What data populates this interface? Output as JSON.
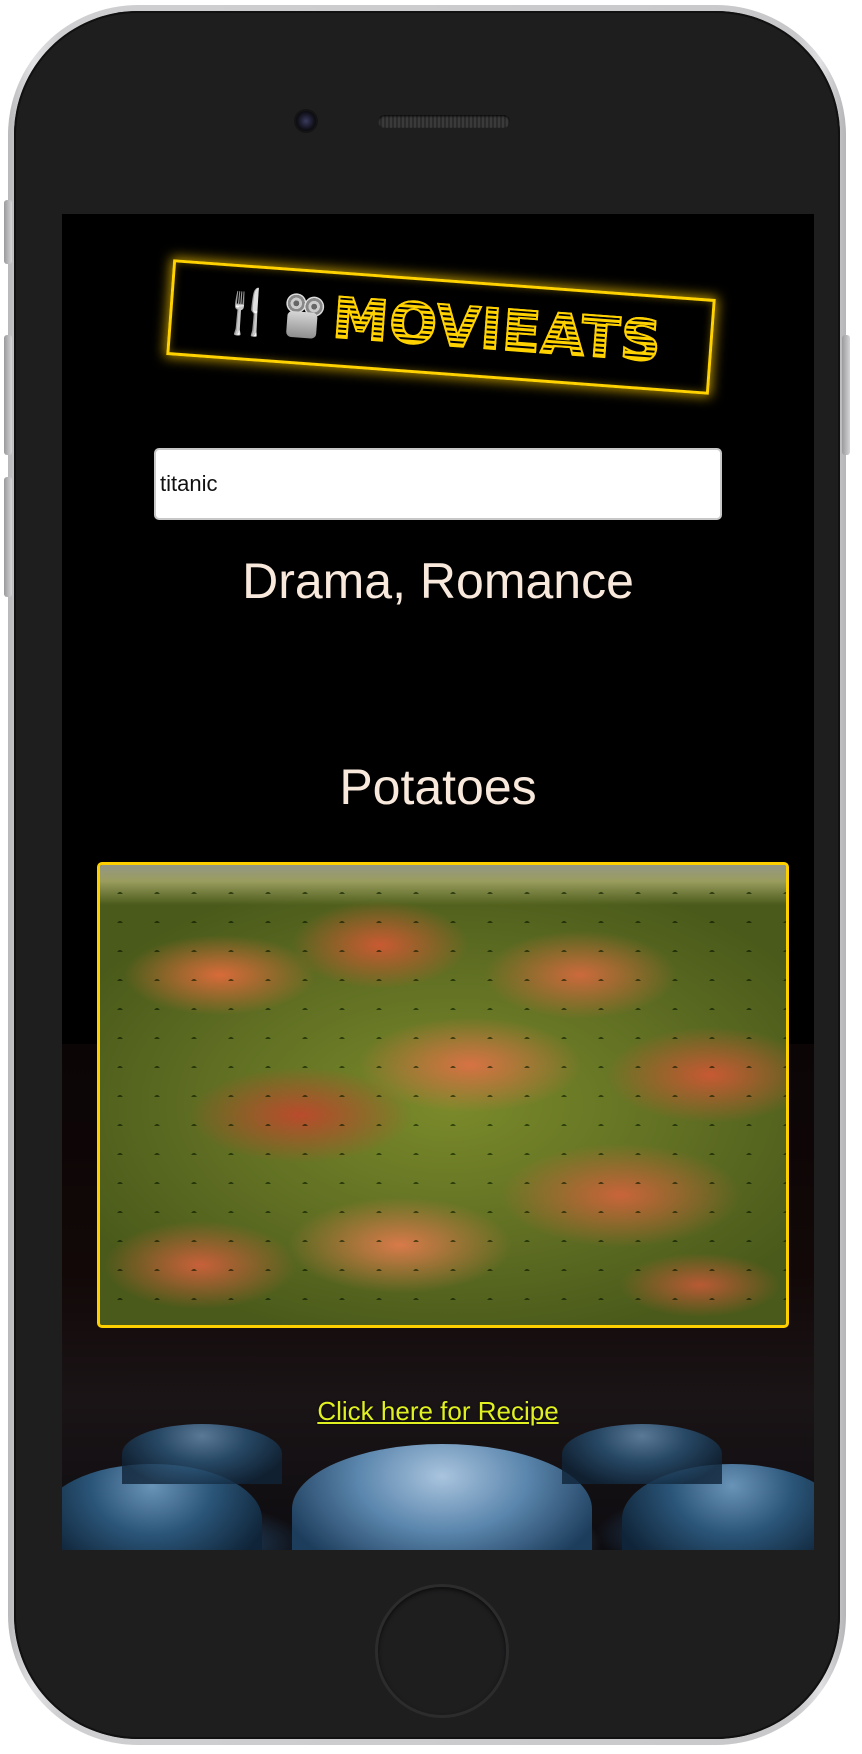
{
  "app": {
    "name": "MOVIEATS",
    "logo_icons": [
      "fork-knife-icon",
      "film-projector-icon"
    ],
    "accent_color": "#ffd200"
  },
  "search": {
    "value": "titanic"
  },
  "results": {
    "genre": "Drama, Romance",
    "dish_name": "Potatoes",
    "recipe_link_label": "Click here for Recipe",
    "link_color": "#e0f020"
  }
}
